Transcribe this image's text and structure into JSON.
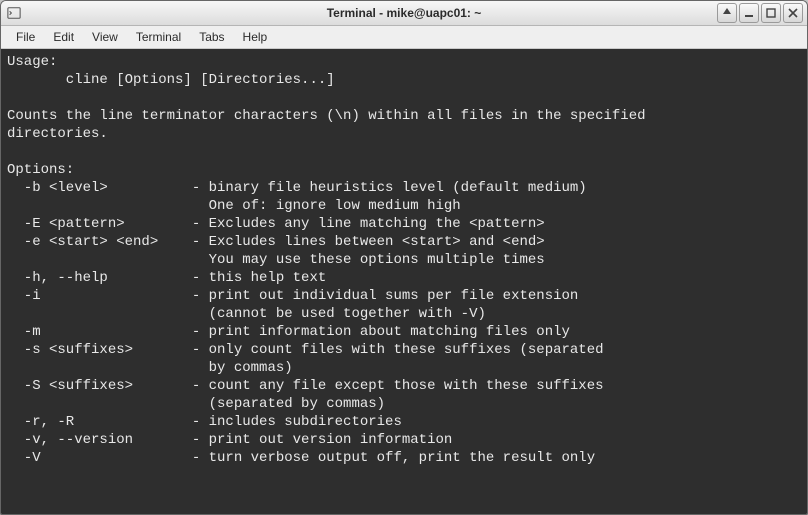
{
  "window": {
    "title": "Terminal - mike@uapc01: ~"
  },
  "menu": {
    "items": [
      "File",
      "Edit",
      "View",
      "Terminal",
      "Tabs",
      "Help"
    ]
  },
  "terminal": {
    "lines": [
      "Usage:",
      "       cline [Options] [Directories...]",
      "",
      "Counts the line terminator characters (\\n) within all files in the specified",
      "directories.",
      "",
      "Options:",
      "  -b <level>          - binary file heuristics level (default medium)",
      "                        One of: ignore low medium high",
      "  -E <pattern>        - Excludes any line matching the <pattern>",
      "  -e <start> <end>    - Excludes lines between <start> and <end>",
      "                        You may use these options multiple times",
      "  -h, --help          - this help text",
      "  -i                  - print out individual sums per file extension",
      "                        (cannot be used together with -V)",
      "  -m                  - print information about matching files only",
      "  -s <suffixes>       - only count files with these suffixes (separated",
      "                        by commas)",
      "  -S <suffixes>       - count any file except those with these suffixes",
      "                        (separated by commas)",
      "  -r, -R              - includes subdirectories",
      "  -v, --version       - print out version information",
      "  -V                  - turn verbose output off, print the result only"
    ]
  }
}
